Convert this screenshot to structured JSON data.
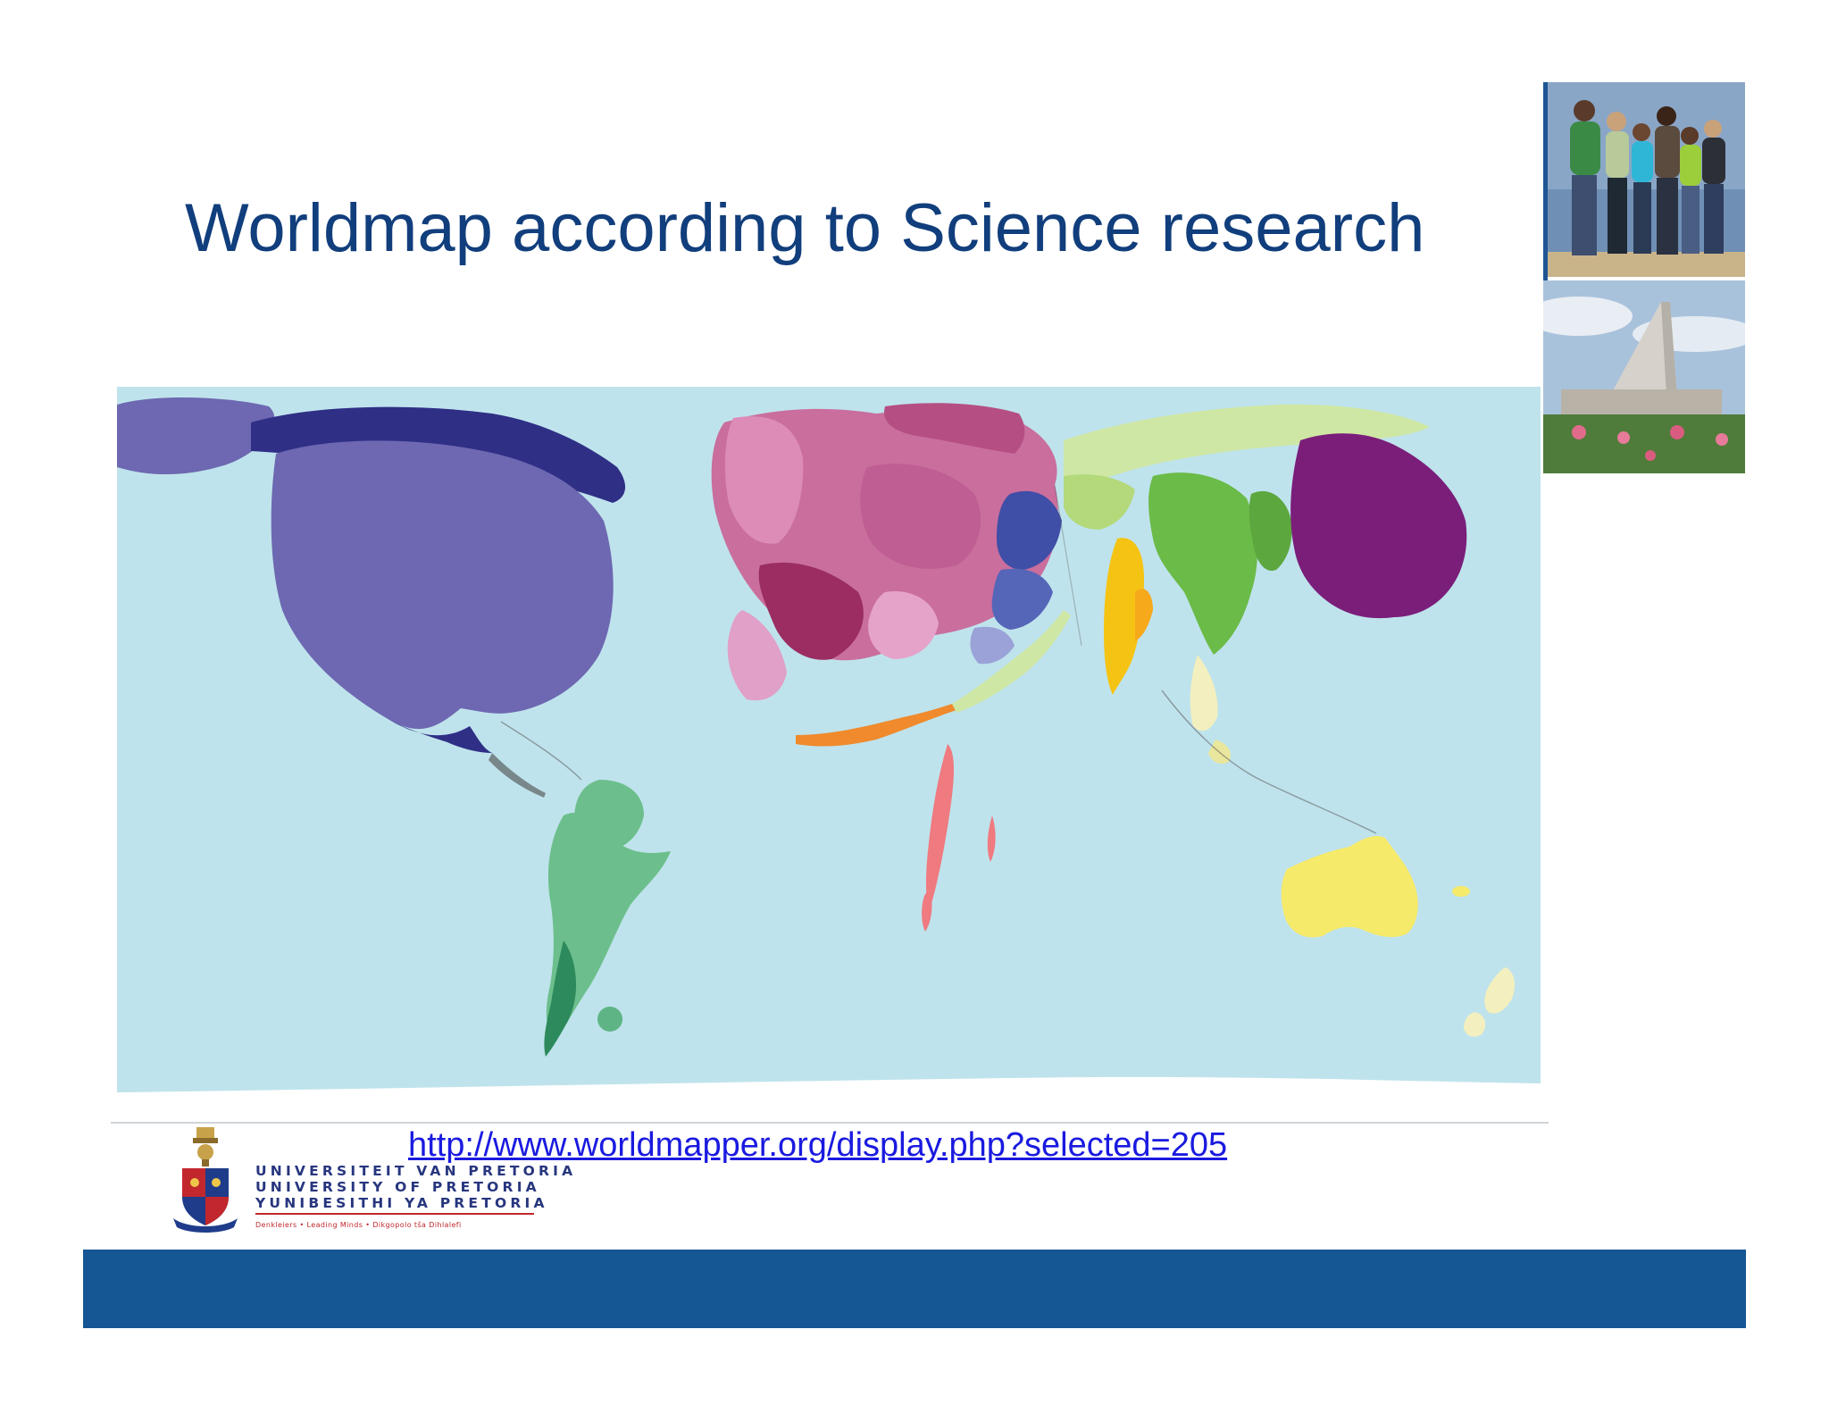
{
  "slide": {
    "title": "Worldmap according to Science research",
    "source_url": "http://www.worldmapper.org/display.php?selected=205"
  },
  "logo": {
    "line1": "UNIVERSITEIT VAN PRETORIA",
    "line2": "UNIVERSITY OF PRETORIA",
    "line3": "YUNIBESITHI YA PRETORIA",
    "tagline": "Denkleiers • Leading Minds • Dikgopolo tša Dihlalefi"
  },
  "colors": {
    "title": "#113e7c",
    "bottom_bar": "#155695",
    "ocean": "#bfe3ec",
    "link": "#1a1ae0"
  },
  "images": {
    "map": "world-cartogram-science-research",
    "photo_top": "students-group-photo",
    "photo_bottom": "campus-building-photo"
  }
}
